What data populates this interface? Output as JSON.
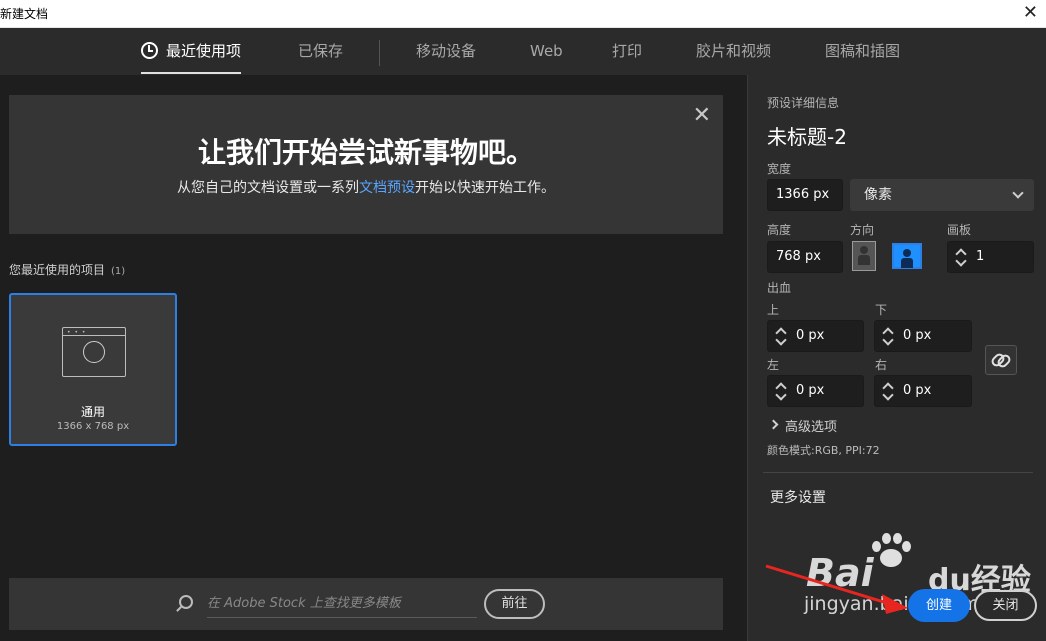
{
  "window": {
    "title": "新建文档",
    "close_icon": "close-icon"
  },
  "tabs": [
    {
      "label": "最近使用项",
      "active": true,
      "icon": "clock-icon"
    },
    {
      "label": "已保存",
      "active": false
    },
    {
      "label": "移动设备",
      "active": false
    },
    {
      "label": "Web",
      "active": false
    },
    {
      "label": "打印",
      "active": false
    },
    {
      "label": "胶片和视频",
      "active": false
    },
    {
      "label": "图稿和插图",
      "active": false
    }
  ],
  "banner": {
    "headline": "让我们开始尝试新事物吧。",
    "sub_prefix": "从您自己的文档设置或一系列",
    "sub_link": "文档预设",
    "sub_suffix": "开始以快速开始工作。"
  },
  "recent": {
    "label": "您最近使用的项目",
    "count": "(1)",
    "items": [
      {
        "name": "通用",
        "dims": "1366 x 768 px"
      }
    ]
  },
  "stock": {
    "placeholder": "在 Adobe Stock 上查找更多模板",
    "go_label": "前往"
  },
  "preset": {
    "section_label": "预设详细信息",
    "doc_name": "未标题-2",
    "width_label": "宽度",
    "width_value": "1366 px",
    "unit": "像素",
    "height_label": "高度",
    "height_value": "768 px",
    "orientation_label": "方向",
    "orientation": "landscape",
    "artboard_label": "画板",
    "artboard_value": "1",
    "bleed_label": "出血",
    "bleed": {
      "top_label": "上",
      "top": "0 px",
      "bottom_label": "下",
      "bottom": "0 px",
      "left_label": "左",
      "left": "0 px",
      "right_label": "右",
      "right": "0 px"
    },
    "advanced": "高级选项",
    "color_mode": "颜色模式:RGB, PPI:72",
    "more_settings": "更多设置"
  },
  "actions": {
    "create": "创建",
    "close": "关闭"
  },
  "watermark": {
    "brand": "Bai",
    "brand2": "du经验",
    "url": "jingyan.baidu.com"
  },
  "colors": {
    "accent": "#1473e6",
    "selection": "#2d7fe6",
    "link": "#59a5ff",
    "annotation_arrow": "#e8261f"
  }
}
